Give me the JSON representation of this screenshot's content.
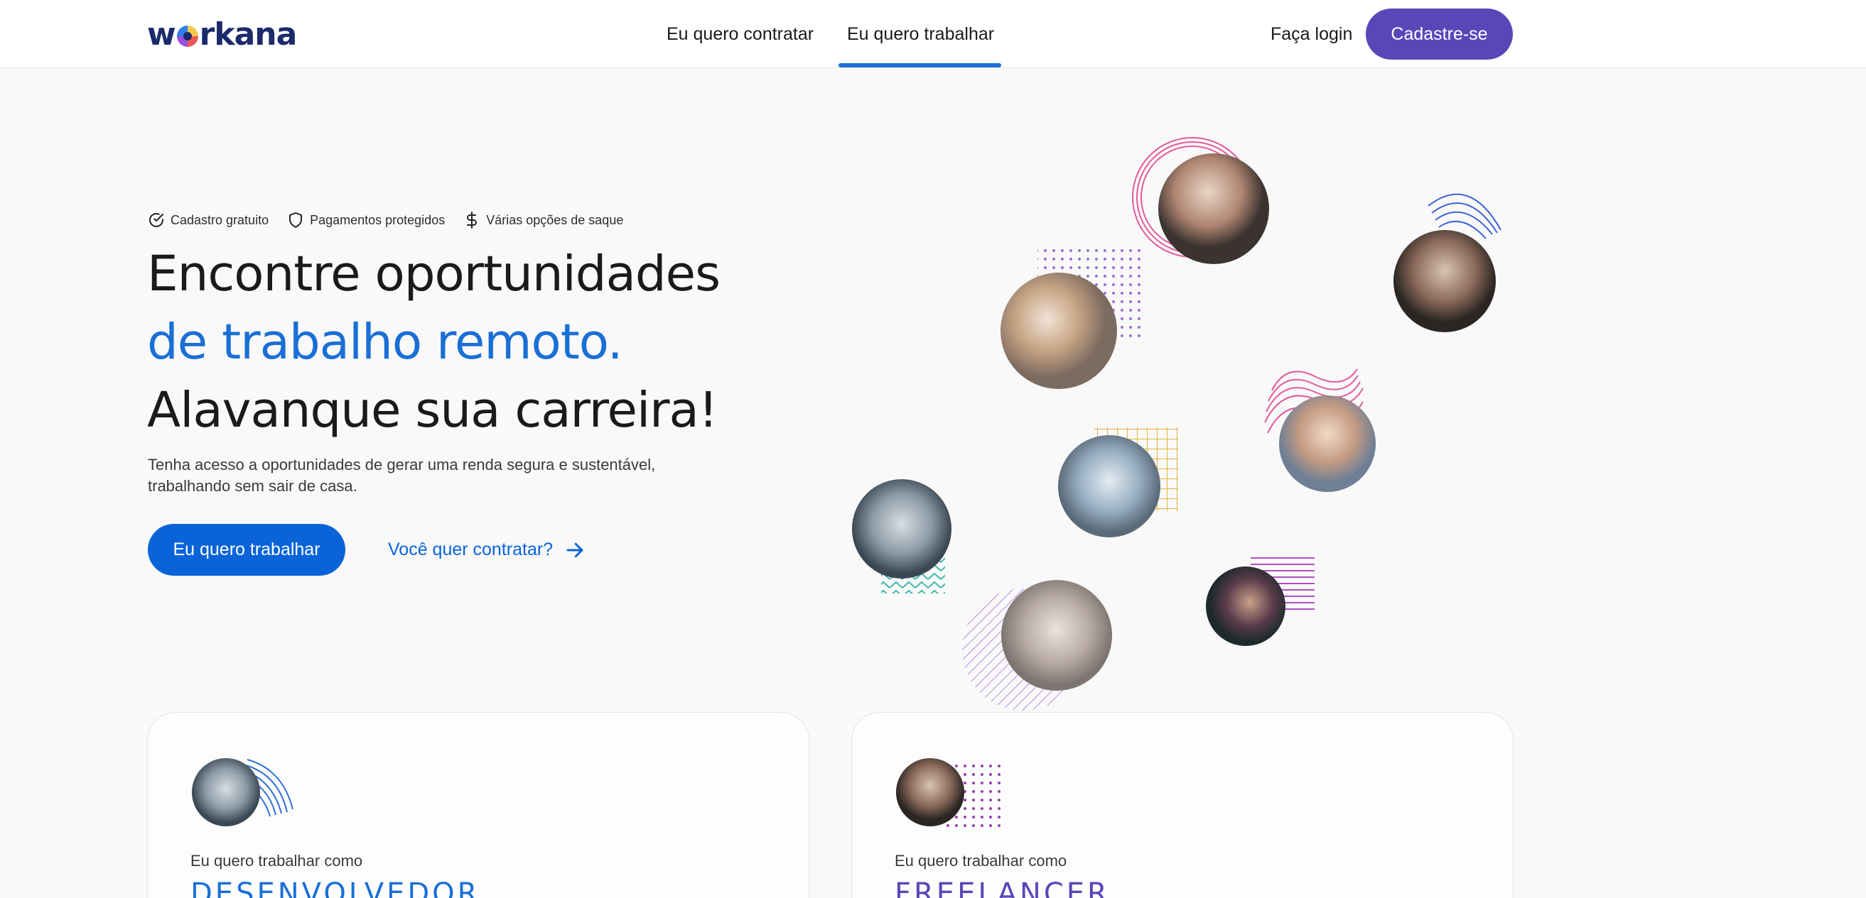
{
  "header": {
    "logo_text_left": "w",
    "logo_text_right": "rkana",
    "tabs": [
      {
        "label": "Eu quero contratar",
        "active": false
      },
      {
        "label": "Eu quero trabalhar",
        "active": true
      }
    ],
    "login_label": "Faça login",
    "signup_label": "Cadastre-se"
  },
  "hero": {
    "badges": [
      {
        "icon": "check-circle-icon",
        "label": "Cadastro gratuito"
      },
      {
        "icon": "shield-icon",
        "label": "Pagamentos protegidos"
      },
      {
        "icon": "dollar-icon",
        "label": "Várias opções de saque"
      }
    ],
    "title_line1": "Encontre oportunidades",
    "title_line2": "de trabalho remoto.",
    "title_line3": "Alavanque sua carreira!",
    "description": "Tenha acesso a oportunidades de gerar uma renda segura e sustentável, trabalhando sem sair de casa.",
    "cta_primary": "Eu quero trabalhar",
    "cta_secondary": "Você quer contratar?"
  },
  "cards": [
    {
      "kicker": "Eu quero trabalhar como",
      "role": "DESENVOLVEDOR"
    },
    {
      "kicker": "Eu quero trabalhar como",
      "role": "FREELANCER"
    }
  ],
  "colors": {
    "brand_blue": "#0a64d8",
    "brand_purple": "#5b46b8",
    "logo_navy": "#1b2a6b",
    "background": "#f9f9f9"
  }
}
